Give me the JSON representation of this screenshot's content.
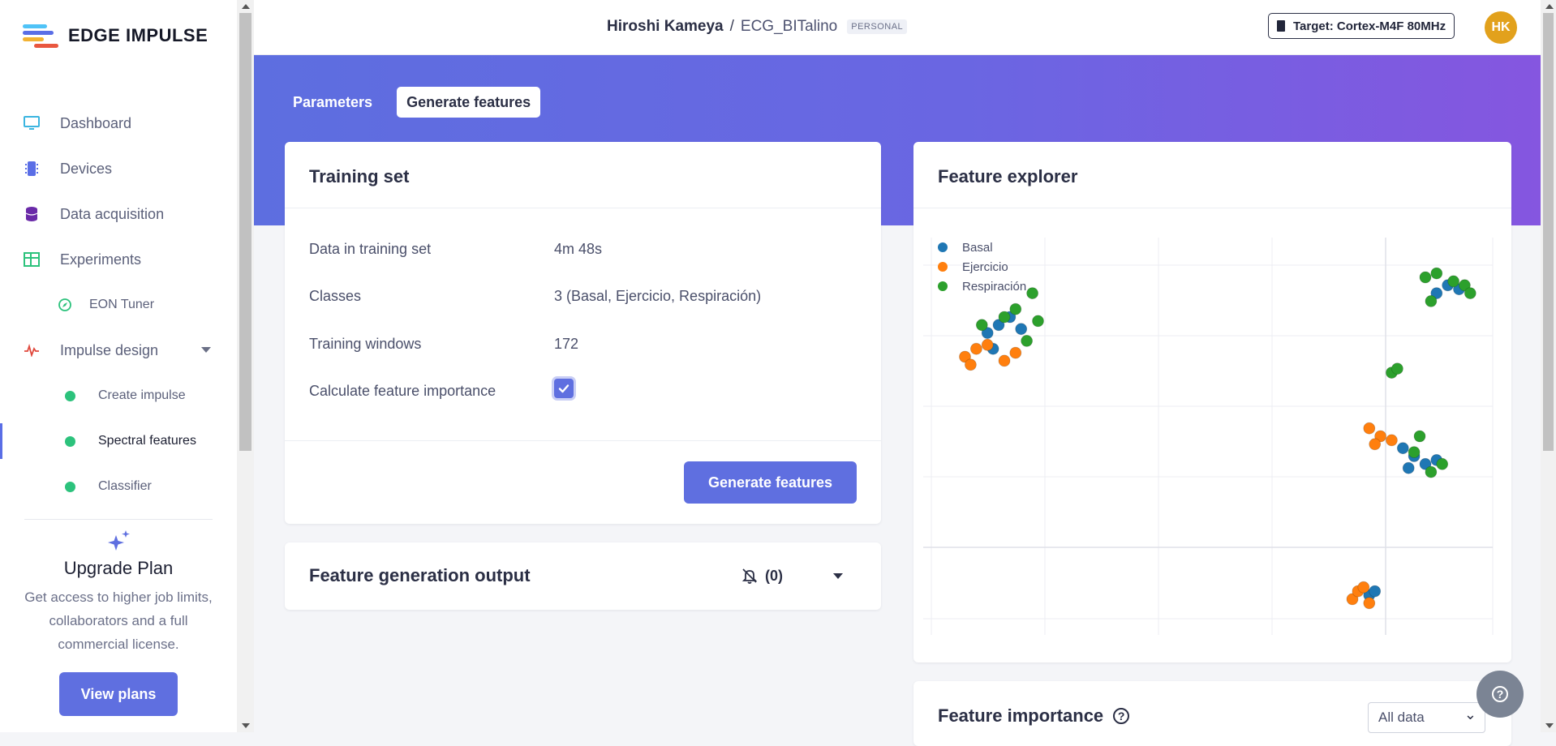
{
  "brand": {
    "name": "EDGE IMPULSE"
  },
  "sidebar": {
    "items": [
      {
        "label": "Dashboard",
        "icon": "monitor-icon",
        "color": "#3bb5e0"
      },
      {
        "label": "Devices",
        "icon": "chip-icon",
        "color": "#5a6ee6"
      },
      {
        "label": "Data acquisition",
        "icon": "database-icon",
        "color": "#6a2aa8"
      },
      {
        "label": "Experiments",
        "icon": "table-icon",
        "color": "#2cc27c"
      },
      {
        "label": "EON Tuner",
        "icon": "compass-icon",
        "color": "#2cc27c"
      },
      {
        "label": "Impulse design",
        "icon": "pulse-icon",
        "color": "#e0483c"
      },
      {
        "label": "Create impulse"
      },
      {
        "label": "Spectral features"
      },
      {
        "label": "Classifier"
      }
    ],
    "upgrade": {
      "title": "Upgrade Plan",
      "text": "Get access to higher job limits, collaborators and a full commercial license.",
      "button": "View plans"
    }
  },
  "header": {
    "user": "Hiroshi Kameya",
    "separator": "/",
    "project": "ECG_BITalino",
    "badge": "PERSONAL",
    "target": "Target: Cortex-M4F 80MHz",
    "avatar_initials": "HK"
  },
  "tabs": [
    {
      "label": "Parameters",
      "active": false
    },
    {
      "label": "Generate features",
      "active": true
    }
  ],
  "training_set": {
    "title": "Training set",
    "rows": [
      {
        "label": "Data in training set",
        "value": "4m 48s"
      },
      {
        "label": "Classes",
        "value": "3 (Basal, Ejercicio, Respiración)"
      },
      {
        "label": "Training windows",
        "value": "172"
      },
      {
        "label": "Calculate feature importance",
        "checked": true
      }
    ],
    "button": "Generate features"
  },
  "feature_output": {
    "title": "Feature generation output",
    "count": "(0)"
  },
  "feature_explorer": {
    "title": "Feature explorer"
  },
  "feature_importance": {
    "title": "Feature importance",
    "select_value": "All data"
  },
  "chart_data": {
    "type": "scatter",
    "series": [
      {
        "name": "Basal",
        "color": "#1f77b4",
        "points": [
          [
            0.1,
            0.76
          ],
          [
            0.12,
            0.78
          ],
          [
            0.14,
            0.8
          ],
          [
            0.16,
            0.77
          ],
          [
            0.11,
            0.72
          ],
          [
            0.9,
            0.86
          ],
          [
            0.92,
            0.88
          ],
          [
            0.94,
            0.87
          ],
          [
            0.84,
            0.47
          ],
          [
            0.86,
            0.45
          ],
          [
            0.88,
            0.43
          ],
          [
            0.9,
            0.44
          ],
          [
            0.85,
            0.42
          ],
          [
            0.78,
            0.1
          ],
          [
            0.79,
            0.11
          ]
        ]
      },
      {
        "name": "Ejercicio",
        "color": "#ff7f0e",
        "points": [
          [
            0.06,
            0.7
          ],
          [
            0.08,
            0.72
          ],
          [
            0.1,
            0.73
          ],
          [
            0.13,
            0.69
          ],
          [
            0.15,
            0.71
          ],
          [
            0.07,
            0.68
          ],
          [
            0.78,
            0.52
          ],
          [
            0.8,
            0.5
          ],
          [
            0.82,
            0.49
          ],
          [
            0.79,
            0.48
          ],
          [
            0.75,
            0.09
          ],
          [
            0.76,
            0.11
          ],
          [
            0.77,
            0.12
          ],
          [
            0.78,
            0.08
          ]
        ]
      },
      {
        "name": "Respiración",
        "color": "#2ca02c",
        "points": [
          [
            0.09,
            0.78
          ],
          [
            0.13,
            0.8
          ],
          [
            0.15,
            0.82
          ],
          [
            0.17,
            0.74
          ],
          [
            0.18,
            0.86
          ],
          [
            0.19,
            0.79
          ],
          [
            0.88,
            0.9
          ],
          [
            0.9,
            0.91
          ],
          [
            0.93,
            0.89
          ],
          [
            0.95,
            0.88
          ],
          [
            0.96,
            0.86
          ],
          [
            0.89,
            0.84
          ],
          [
            0.82,
            0.66
          ],
          [
            0.83,
            0.67
          ],
          [
            0.86,
            0.46
          ],
          [
            0.89,
            0.41
          ],
          [
            0.91,
            0.43
          ],
          [
            0.87,
            0.5
          ]
        ]
      }
    ]
  }
}
